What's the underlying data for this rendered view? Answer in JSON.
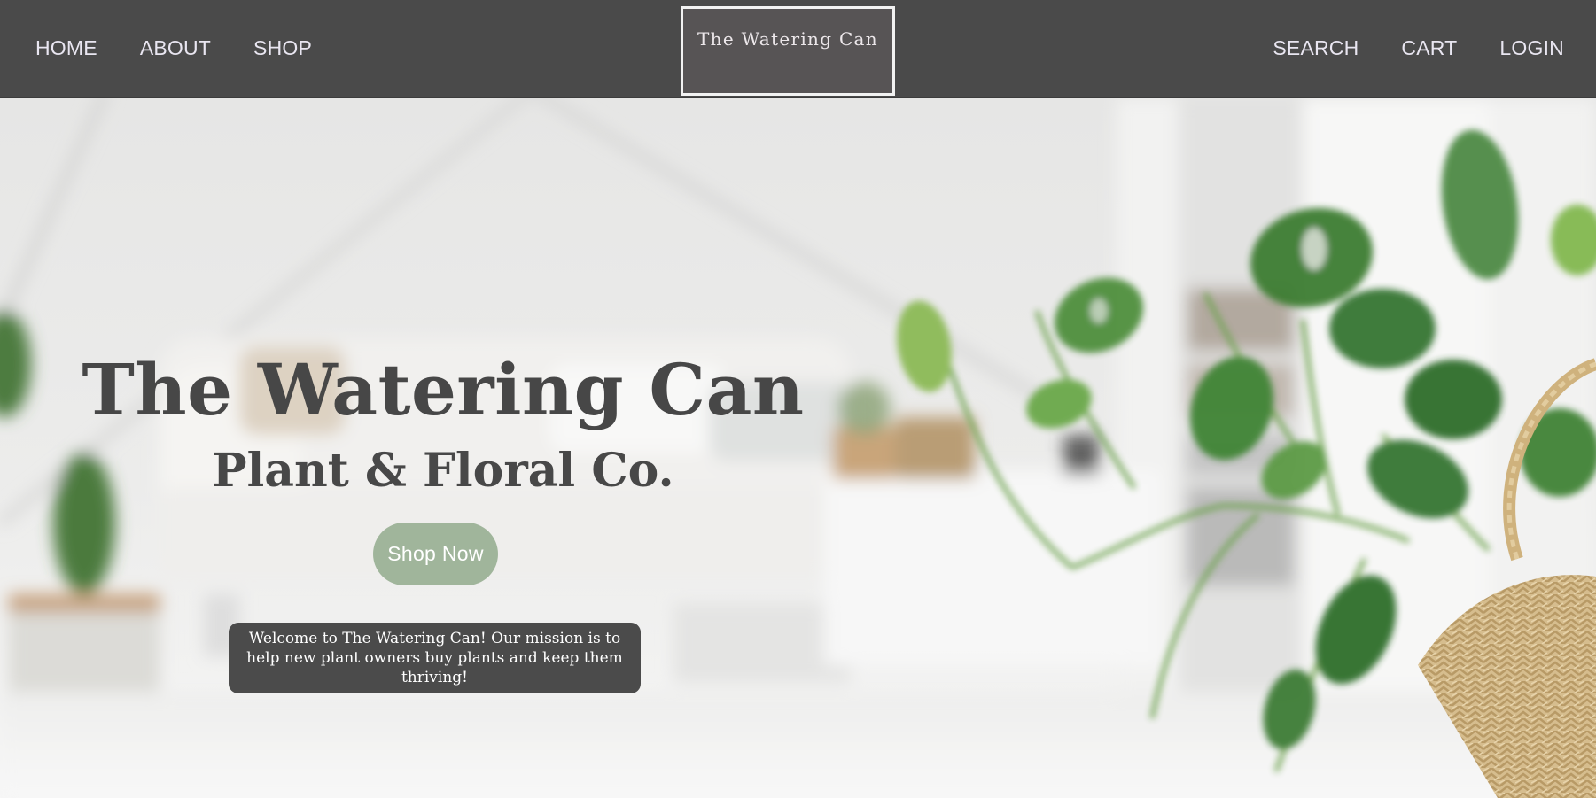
{
  "nav": {
    "left": [
      "HOME",
      "ABOUT",
      "SHOP"
    ],
    "right": [
      "SEARCH",
      "CART",
      "LOGIN"
    ],
    "logo": "The Watering Can",
    "bg_color": "#4a4a4a",
    "link_color": "#e9e6f1"
  },
  "hero": {
    "title": "The Watering Can",
    "subtitle": "Plant & Floral Co.",
    "cta_label": "Shop Now",
    "cta_color": "#a0b59b",
    "message": "Welcome to The Watering Can! Our mission is to help new plant owners buy plants and keep them thriving!",
    "background": "blurred-living-room-with-potted-plant-photo"
  }
}
